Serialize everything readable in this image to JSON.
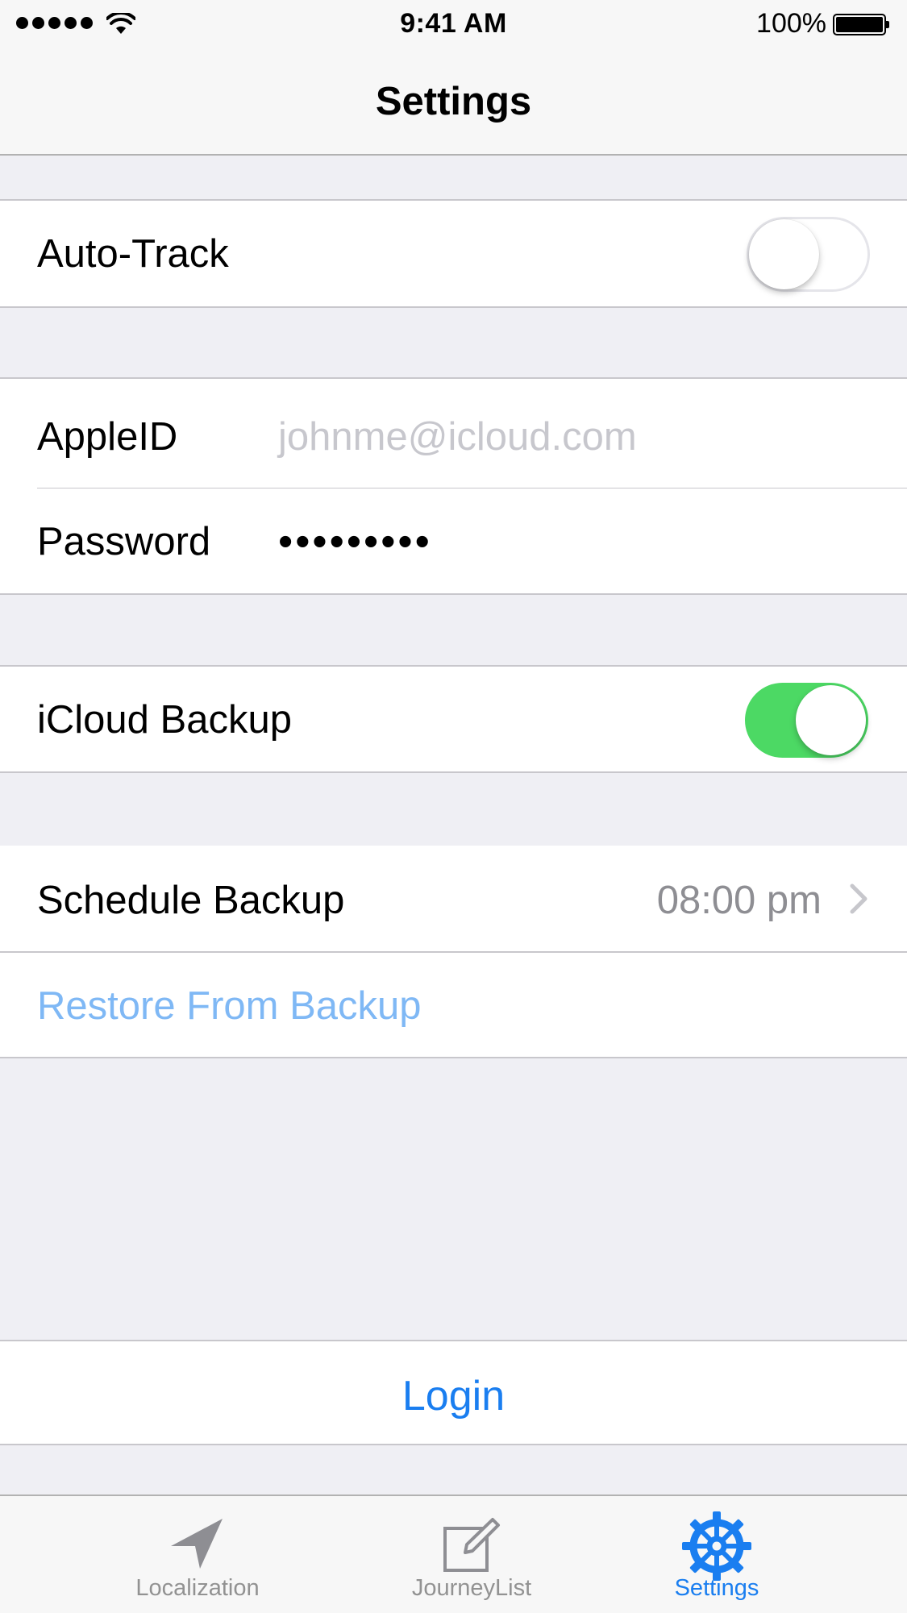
{
  "status_bar": {
    "time": "9:41 AM",
    "battery": "100%"
  },
  "nav": {
    "title": "Settings"
  },
  "auto_track": {
    "label": "Auto-Track",
    "on": false
  },
  "account": {
    "apple_id_label": "AppleID",
    "apple_id_placeholder": "johnme@icloud.com",
    "password_label": "Password",
    "password_value": "•••••••••"
  },
  "icloud_backup": {
    "label": "iCloud Backup",
    "on": true
  },
  "schedule": {
    "label": "Schedule Backup",
    "value": "08:00 pm",
    "restore_label": "Restore From Backup"
  },
  "login": {
    "label": "Login"
  },
  "tab_bar": {
    "tabs": [
      {
        "label": "Localization",
        "icon": "location-arrow-icon",
        "active": false
      },
      {
        "label": "JourneyList",
        "icon": "compose-icon",
        "active": false
      },
      {
        "label": "Settings",
        "icon": "gear-icon",
        "active": true
      }
    ]
  },
  "colors": {
    "accent": "#1a7ef0",
    "switch_on": "#4cd964",
    "link_disabled": "#7fb8f5",
    "inactive_tab": "#929292"
  }
}
